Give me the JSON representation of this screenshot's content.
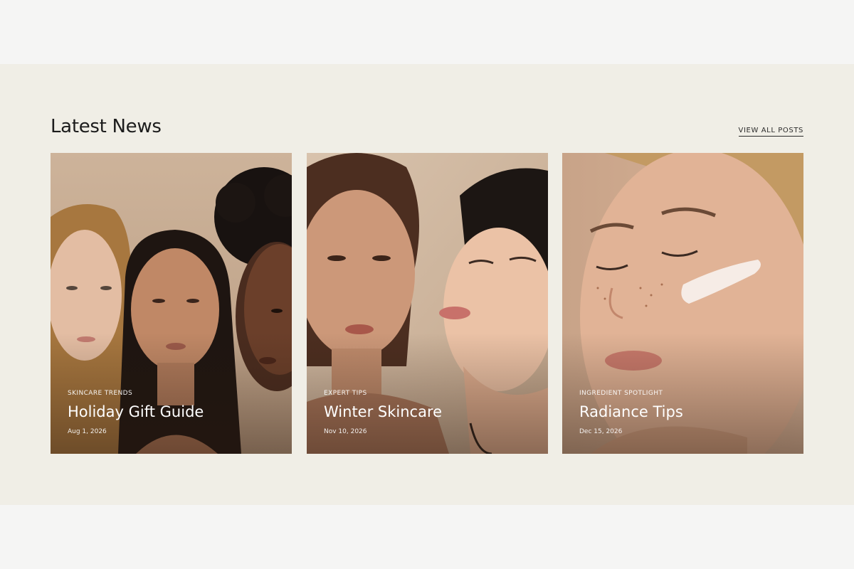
{
  "section": {
    "title": "Latest News",
    "view_all_label": "VIEW ALL POSTS"
  },
  "posts": [
    {
      "category": "SKINCARE TRENDS",
      "title": "Holiday Gift Guide",
      "date": "Aug 1, 2026"
    },
    {
      "category": "EXPERT TIPS",
      "title": "Winter Skincare",
      "date": "Nov 10, 2026"
    },
    {
      "category": "INGREDIENT SPOTLIGHT",
      "title": "Radiance Tips",
      "date": "Dec 15, 2026"
    }
  ],
  "colors": {
    "band_background": "#f0eee6",
    "page_background": "#f5f5f4",
    "text_dark": "#1c1c1c"
  }
}
